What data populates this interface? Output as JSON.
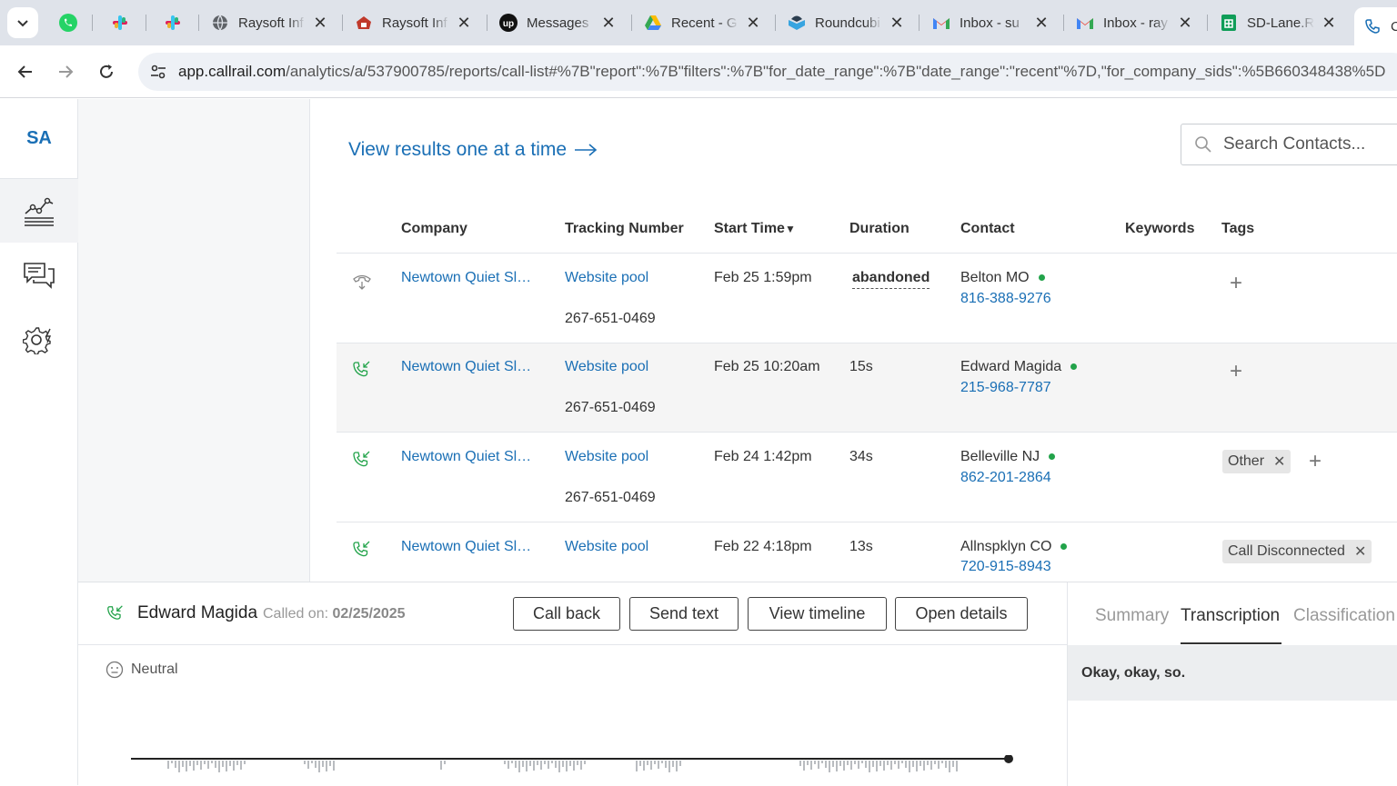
{
  "browser": {
    "tabs": [
      {
        "label": "Raysoft Inf",
        "icon": "globe-icon"
      },
      {
        "label": "Raysoft Inf",
        "icon": "raysoft-icon"
      },
      {
        "label": "Messages",
        "icon": "upwork-icon"
      },
      {
        "label": "Recent - G",
        "icon": "drive-icon"
      },
      {
        "label": "Roundcubi",
        "icon": "roundcube-icon"
      },
      {
        "label": "Inbox - su",
        "icon": "gmail-icon"
      },
      {
        "label": "Inbox - ray",
        "icon": "gmail-icon"
      },
      {
        "label": "SD-Lane.R",
        "icon": "sheets-icon"
      },
      {
        "label": "C",
        "icon": "callrail-icon"
      }
    ],
    "url_host": "app.callrail.com",
    "url_path": "/analytics/a/537900785/reports/call-list#%7B\"report\":%7B\"filters\":%7B\"for_date_range\":%7B\"date_range\":\"recent\"%7D,\"for_company_sids\":%5B660348438%5D"
  },
  "app": {
    "logo": "SA",
    "view_results": "View results one at a time",
    "search_placeholder": "Search Contacts..."
  },
  "table": {
    "headers": {
      "company": "Company",
      "tracking": "Tracking Number",
      "start": "Start Time",
      "sort_arrow": "▼",
      "duration": "Duration",
      "contact": "Contact",
      "keywords": "Keywords",
      "tags": "Tags"
    },
    "rows": [
      {
        "company": "Newtown Quiet Sl…",
        "pool": "Website pool",
        "number": "267-651-0469",
        "start": "Feb 25 1:59pm",
        "duration": "abandoned",
        "contact": "Belton MO",
        "phone": "816-388-9276",
        "tag": ""
      },
      {
        "company": "Newtown Quiet Sl…",
        "pool": "Website pool",
        "number": "267-651-0469",
        "start": "Feb 25 10:20am",
        "duration": "15s",
        "contact": "Edward Magida",
        "phone": "215-968-7787",
        "tag": ""
      },
      {
        "company": "Newtown Quiet Sl…",
        "pool": "Website pool",
        "number": "267-651-0469",
        "start": "Feb 24 1:42pm",
        "duration": "34s",
        "contact": "Belleville NJ",
        "phone": "862-201-2864",
        "tag": "Other"
      },
      {
        "company": "Newtown Quiet Sl…",
        "pool": "Website pool",
        "number": "",
        "start": "Feb 22 4:18pm",
        "duration": "13s",
        "contact": "Allnspklyn CO",
        "phone": "720-915-8943",
        "tag": "Call Disconnected"
      }
    ]
  },
  "detail": {
    "caller": "Edward Magida",
    "called_on_label": "Called on:",
    "called_on_date": "02/25/2025",
    "buttons": {
      "call_back": "Call back",
      "send_text": "Send text",
      "view_timeline": "View timeline",
      "open_details": "Open details"
    },
    "sentiment": "Neutral",
    "tabs": {
      "summary": "Summary",
      "transcription": "Transcription",
      "classification": "Classification"
    },
    "transcript_line": "Okay, okay, so."
  },
  "colors": {
    "accent": "#1a6fb5",
    "status_green": "#22a34a"
  }
}
